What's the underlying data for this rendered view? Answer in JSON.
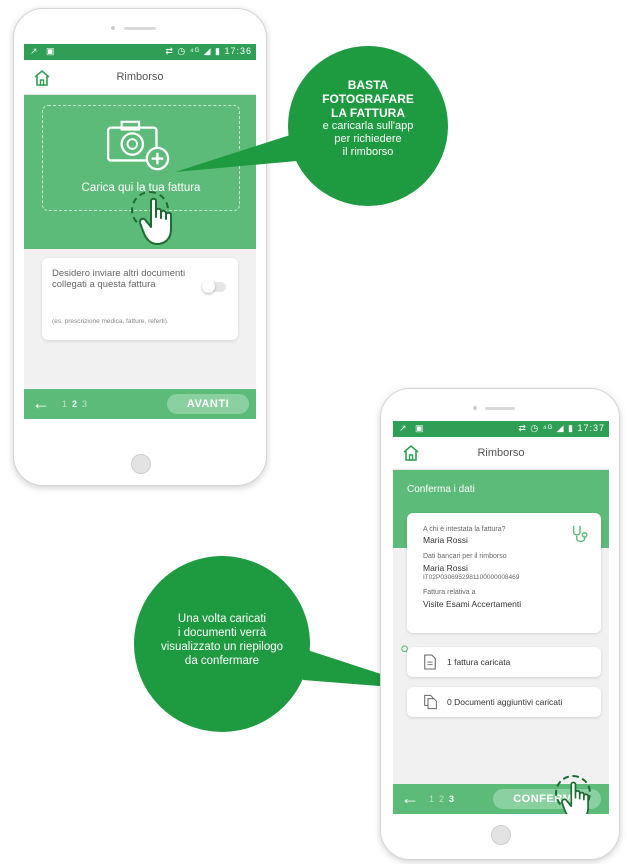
{
  "colors": {
    "green_dark": "#1e9a40",
    "green_mid": "#2e9f55",
    "green_light": "#5dbb7a",
    "button": "#8ad0a0"
  },
  "callout_top": {
    "bold_lines": [
      "BASTA",
      "FOTOGRAFARE",
      "LA FATTURA"
    ],
    "lines": [
      "e caricarla sull'app",
      "per richiedere",
      "il rimborso"
    ]
  },
  "callout_bottom": {
    "lines": [
      "Una volta caricati",
      "i documenti verrà",
      "visualizzato un riepilogo",
      "da confermare"
    ]
  },
  "phone1": {
    "status_time": "17:36",
    "status_icons": "⇄ ◷ ⁴ᴳ ◢ ▮",
    "title": "Rimborso",
    "upload_label": "Carica qui la tua fattura",
    "toggle_card": {
      "text": "Desidero inviare altri documenti collegati a questa fattura",
      "hint": "(es. prescrizione medica, fatture, referti)."
    },
    "steps": [
      "1",
      "2",
      "3"
    ],
    "active_step": 2,
    "next_button": "AVANTI"
  },
  "phone2": {
    "status_time": "17:37",
    "status_icons": "⇄ ◷ ⁴ᴳ ◢ ▮",
    "title": "Rimborso",
    "section_title": "Conferma i dati",
    "summary": {
      "q1_label": "A chi è intestata la fattura?",
      "q1_value": "Maria Rossi",
      "q2_label": "Dati bancari per il rimborso",
      "q2_value": "Maria Rossi",
      "iban": "IT02P0306952981100000008469",
      "q3_label": "Fattura relativa a",
      "q3_value": "Visite Esami Accertamenti"
    },
    "doc1": "1 fattura caricata",
    "doc2": "0 Documenti aggiuntivi caricati",
    "steps": [
      "1",
      "2",
      "3"
    ],
    "active_step": 3,
    "confirm_button": "CONFERMA"
  }
}
